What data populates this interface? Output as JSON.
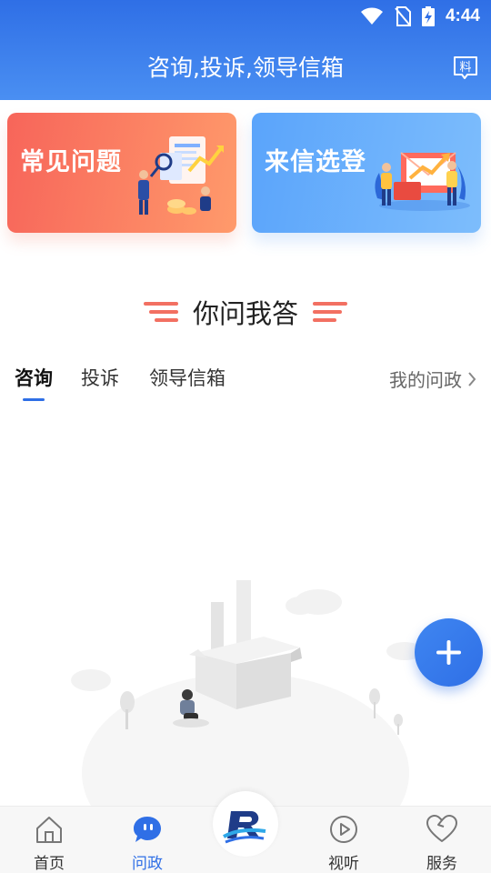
{
  "status_bar": {
    "time": "4:44",
    "icons": [
      "wifi-icon",
      "no-sim-icon",
      "battery-charging-icon"
    ]
  },
  "header": {
    "title": "咨询,投诉,领导信箱",
    "right_icon": "material-icon",
    "right_icon_text": "料"
  },
  "cards": [
    {
      "label": "常见问题",
      "icon": "faq-illustration"
    },
    {
      "label": "来信选登",
      "icon": "letters-illustration"
    }
  ],
  "section": {
    "title": "你问我答"
  },
  "tabs": [
    {
      "label": "咨询",
      "active": true
    },
    {
      "label": "投诉",
      "active": false
    },
    {
      "label": "领导信箱",
      "active": false
    }
  ],
  "my_link": {
    "label": "我的问政",
    "icon": "chevron-right-icon"
  },
  "fab": {
    "icon": "plus-icon"
  },
  "bottom_nav": [
    {
      "label": "首页",
      "icon": "home-icon",
      "active": false
    },
    {
      "label": "问政",
      "icon": "chat-bubble-icon",
      "active": true
    },
    {
      "label": "",
      "icon": "brand-logo-icon",
      "active": false
    },
    {
      "label": "视听",
      "icon": "play-icon",
      "active": false
    },
    {
      "label": "服务",
      "icon": "heart-icon",
      "active": false
    }
  ],
  "colors": {
    "primary": "#2f6fe6",
    "card_orange": "#f7655a",
    "card_blue": "#5aa4fb"
  }
}
